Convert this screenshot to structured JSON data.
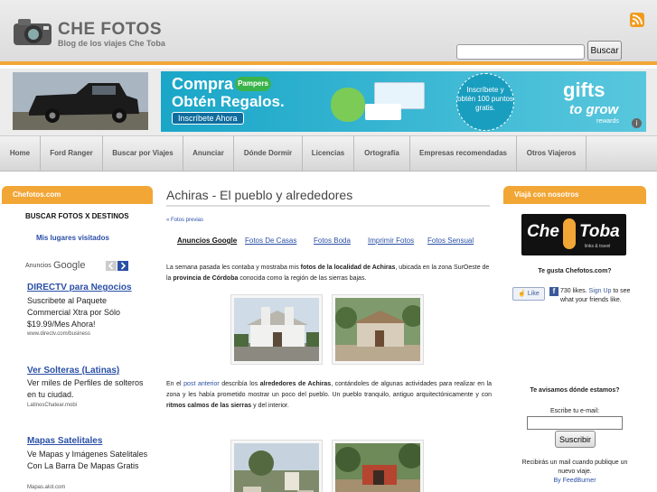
{
  "header": {
    "site_title": "CHE FOTOS",
    "tagline": "Blog de los viajes Che Toba",
    "search_button": "Buscar",
    "search_value": ""
  },
  "banner_ad": {
    "line1": "Compra",
    "line2": "Obtén Regalos.",
    "brand": "Pampers",
    "cta": "Inscríbete Ahora",
    "circle_text": "Inscríbete y obtén 100 puntos gratis.",
    "gifts": "gifts",
    "to_grow": "to grow",
    "rewards": "rewards",
    "info": "i"
  },
  "nav": [
    "Home",
    "Ford Ranger",
    "Buscar por Viajes",
    "Anunciar",
    "Dónde Dormir",
    "Licencias",
    "Ortografía",
    "Empresas recomendadas",
    "Otros Viajeros"
  ],
  "left": {
    "header": "Chefotos.com",
    "buscar": "BUSCAR FOTOS X DESTINOS",
    "lugares": "Mis lugares visitados",
    "anuncios": "Anuncios",
    "google": "Google",
    "ads": [
      {
        "title": "DIRECTV para Negocios",
        "body": "Suscribete al Paquete Commercial Xtra por Sólo $19.99/Mes Ahora!",
        "url": "www.directv.com/business"
      },
      {
        "title": "Ver Solteras (Latinas)",
        "body": "Ver miles de Perfiles de solteros en tu ciudad.",
        "url": "LatinosChatear.mobi"
      },
      {
        "title": "Mapas Satelitales",
        "body": "Ve Mapas y Imágenes Satelitales Con La Barra De Mapas Gratis",
        "url": "Mapas.alot.com"
      }
    ]
  },
  "main": {
    "title": "Achiras - El pueblo y alrededores",
    "prev": "« Fotos previas",
    "ad_links": [
      "Anuncios Google",
      "Fotos De Casas",
      "Fotos Boda",
      "Imprimir Fotos",
      "Fotos Sensual"
    ],
    "p1_a": "La semana pasada les contaba y mostraba mis ",
    "p1_b": "fotos de la localidad de Achiras",
    "p1_c": ", ubicada en la zona SurOeste de la ",
    "p1_d": "provincia de Córdoba",
    "p1_e": " conocida como la región de las sierras bajas.",
    "p2_a": "En el ",
    "p2_b": "post anterior",
    "p2_c": " describía los ",
    "p2_d": "alrededores de Achiras",
    "p2_e": ", contándoles de algunas actividades para realizar en la zona y les había prometido mostrar un poco del pueblo. Un pueblo tranquilo, antiguo arquitectónicamente y con ",
    "p2_f": "ritmos calmos de las sierras",
    "p2_g": " y del interior."
  },
  "right": {
    "header": "Viajá con nosotros",
    "brand_che": "Che",
    "brand_toba": "Toba",
    "brand_sub": "links & travel",
    "gusta": "Te gusta Chefotos.com?",
    "like": "Like",
    "likes_a": "730 likes.",
    "likes_b": "Sign Up",
    "likes_c": " to see what your friends like.",
    "avisamos": "Te avisamos dónde estamos?",
    "email_label": "Escribe tu e-mail:",
    "suscribir": "Suscribir",
    "recibiras": "Recibirás un mail cuando publique un nuevo viaje.",
    "feedburner": "By FeedBurner"
  },
  "colors": {
    "accent": "#f2a636",
    "link": "#2a4fa6",
    "ad_blue": "#1aa6c8"
  }
}
